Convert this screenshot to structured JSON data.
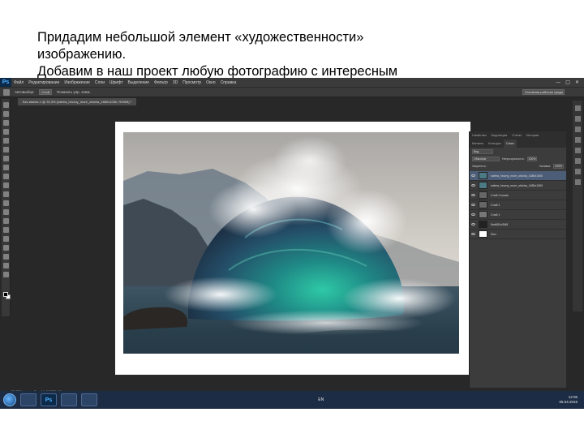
{
  "slide": {
    "lines": [
      "Придадим небольшой элемент «художественности»",
      "изображению.",
      "Добавим в наш проект любую фотографию с интересным"
    ]
  },
  "photoshop": {
    "logo": "Ps",
    "menu": [
      "Файл",
      "Редактирование",
      "Изображение",
      "Слои",
      "Шрифт",
      "Выделение",
      "Фильтр",
      "3D",
      "Просмотр",
      "Окно",
      "Справка"
    ],
    "window_buttons": [
      "—",
      "□",
      "✕"
    ],
    "options": {
      "auto_select_label": "Автовыбор:",
      "auto_select_value": "Слой",
      "show_controls_label": "Показать упр. элем."
    },
    "workspace": "Основная рабочая среда",
    "document_tab": "Без имени-1 @ 33,3% (nafrea_hrozny_more_obloha_1680x1050, RGB/8) *",
    "status": [
      "33,33%",
      "Док: 14,4М/226,4М"
    ],
    "panels": {
      "tabs": [
        "Свойства",
        "Коррекция",
        "Стили",
        "Каналы",
        "Контуры",
        "Слои",
        "История"
      ],
      "active_tab": "Слои",
      "filter_kind": "Вид",
      "blend_mode": "Обычные",
      "opacity_label": "Непрозрачность:",
      "opacity_value": "100%",
      "lock_label": "Закрепить:",
      "fill_label": "Заливка:",
      "fill_value": "100%",
      "layers": [
        {
          "name": "nafrea_hrozny_more_obloha_1680x1050",
          "selected": true
        },
        {
          "name": "nafrea_hrozny_more_obloha_1680x1050",
          "selected": false
        },
        {
          "name": "Слой 2 копия",
          "selected": false
        },
        {
          "name": "Слой 2",
          "selected": false
        },
        {
          "name": "Слой 1",
          "selected": false
        },
        {
          "name": "5rwM2rIc3M8",
          "selected": false
        },
        {
          "name": "Фон",
          "selected": false
        }
      ]
    }
  },
  "taskbar": {
    "photoshop_label": "Ps",
    "language": "EN",
    "time": "12:06",
    "date": "05.04.2016"
  },
  "colors": {
    "ui_dark": "#282828",
    "taskbar": "#1c2c44",
    "layer_selected": "#4c5d78"
  }
}
